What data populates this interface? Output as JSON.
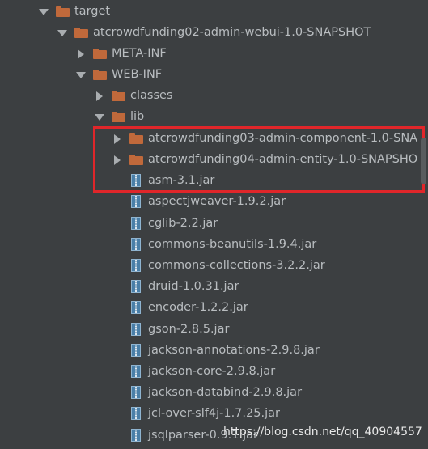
{
  "tree": {
    "items": [
      {
        "label": "target",
        "icon": "folder-icon",
        "arrow": "expanded"
      },
      {
        "label": "atcrowdfunding02-admin-webui-1.0-SNAPSHOT",
        "icon": "folder-icon",
        "arrow": "expanded"
      },
      {
        "label": "META-INF",
        "icon": "folder-icon",
        "arrow": "collapsed"
      },
      {
        "label": "WEB-INF",
        "icon": "folder-icon",
        "arrow": "expanded"
      },
      {
        "label": "classes",
        "icon": "folder-icon",
        "arrow": "collapsed"
      },
      {
        "label": "lib",
        "icon": "folder-icon",
        "arrow": "expanded"
      },
      {
        "label": "atcrowdfunding03-admin-component-1.0-SNA",
        "icon": "folder-icon",
        "arrow": "collapsed"
      },
      {
        "label": "atcrowdfunding04-admin-entity-1.0-SNAPSHO",
        "icon": "folder-icon",
        "arrow": "collapsed"
      },
      {
        "label": "asm-3.1.jar",
        "icon": "jar-icon",
        "arrow": "none"
      },
      {
        "label": "aspectjweaver-1.9.2.jar",
        "icon": "jar-icon",
        "arrow": "none"
      },
      {
        "label": "cglib-2.2.jar",
        "icon": "jar-icon",
        "arrow": "none"
      },
      {
        "label": "commons-beanutils-1.9.4.jar",
        "icon": "jar-icon",
        "arrow": "none"
      },
      {
        "label": "commons-collections-3.2.2.jar",
        "icon": "jar-icon",
        "arrow": "none"
      },
      {
        "label": "druid-1.0.31.jar",
        "icon": "jar-icon",
        "arrow": "none"
      },
      {
        "label": "encoder-1.2.2.jar",
        "icon": "jar-icon",
        "arrow": "none"
      },
      {
        "label": "gson-2.8.5.jar",
        "icon": "jar-icon",
        "arrow": "none"
      },
      {
        "label": "jackson-annotations-2.9.8.jar",
        "icon": "jar-icon",
        "arrow": "none"
      },
      {
        "label": "jackson-core-2.9.8.jar",
        "icon": "jar-icon",
        "arrow": "none"
      },
      {
        "label": "jackson-databind-2.9.8.jar",
        "icon": "jar-icon",
        "arrow": "none"
      },
      {
        "label": "jcl-over-slf4j-1.7.25.jar",
        "icon": "jar-icon",
        "arrow": "none"
      },
      {
        "label": "jsqlparser-0.9.1.jar",
        "icon": "jar-icon",
        "arrow": "none"
      }
    ]
  },
  "watermark": "https://blog.csdn.net/qq_40904557",
  "colors": {
    "background": "#3c3f41",
    "text": "#b9bdc0",
    "folder": "#c0693b",
    "highlight_border": "#e0262a"
  }
}
